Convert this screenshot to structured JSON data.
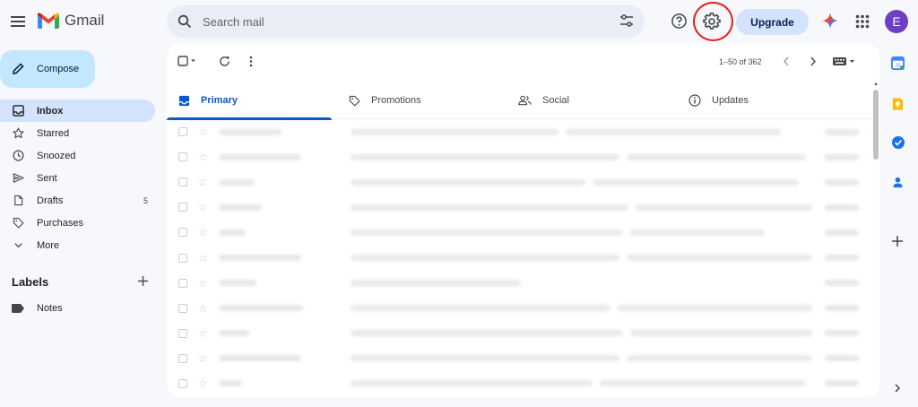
{
  "header": {
    "app_name": "Gmail",
    "search_placeholder": "Search mail",
    "upgrade_label": "Upgrade",
    "avatar_initial": "E"
  },
  "sidebar": {
    "compose_label": "Compose",
    "items": [
      {
        "label": "Inbox",
        "icon": "inbox-icon",
        "active": true,
        "count": ""
      },
      {
        "label": "Starred",
        "icon": "star-icon",
        "active": false,
        "count": ""
      },
      {
        "label": "Snoozed",
        "icon": "clock-icon",
        "active": false,
        "count": ""
      },
      {
        "label": "Sent",
        "icon": "send-icon",
        "active": false,
        "count": ""
      },
      {
        "label": "Drafts",
        "icon": "draft-icon",
        "active": false,
        "count": "5"
      },
      {
        "label": "Purchases",
        "icon": "tag-icon",
        "active": false,
        "count": ""
      },
      {
        "label": "More",
        "icon": "chevron-down-icon",
        "active": false,
        "count": ""
      }
    ],
    "labels_title": "Labels",
    "labels": [
      {
        "label": "Notes",
        "icon": "label-icon"
      }
    ]
  },
  "main": {
    "pager": "1–50 of 362",
    "tabs": [
      {
        "label": "Primary",
        "icon": "inbox-icon",
        "active": true
      },
      {
        "label": "Promotions",
        "icon": "tag-icon",
        "active": false
      },
      {
        "label": "Social",
        "icon": "people-icon",
        "active": false
      },
      {
        "label": "Updates",
        "icon": "info-icon",
        "active": false
      }
    ],
    "blurred_row_count": 11
  },
  "colors": {
    "accent": "#0b57d0",
    "compose_bg": "#c2e7ff",
    "active_nav_bg": "#d3e3fd",
    "highlight_circle": "#e02020",
    "avatar_bg": "#6d3fc4"
  }
}
